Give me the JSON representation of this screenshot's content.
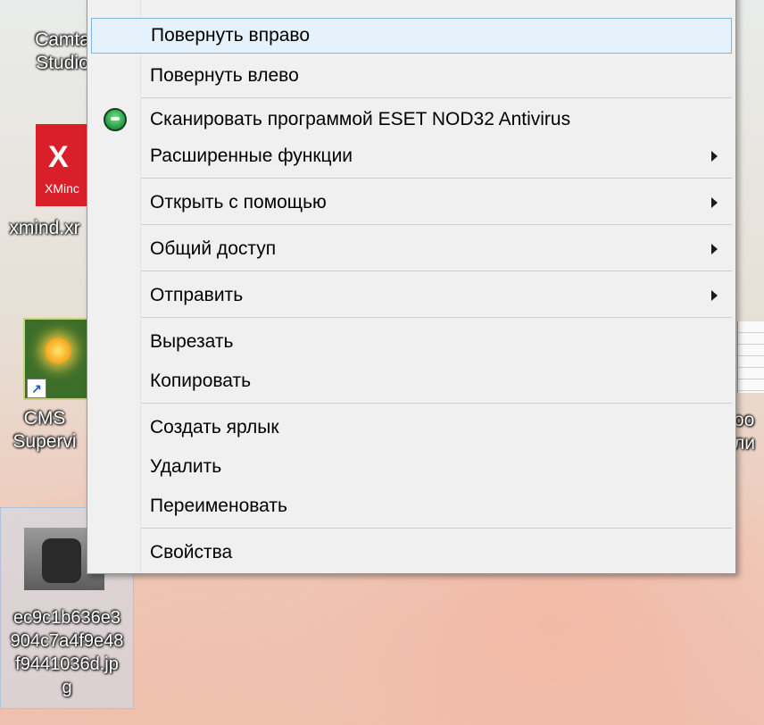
{
  "desktop": {
    "icons": [
      {
        "label_line1": "Camta",
        "label_line2": "Studio"
      },
      {
        "tile_letter": "X",
        "tile_text": "XMinc",
        "label_line1": "xmind.xr"
      },
      {
        "label_line1": "CMS",
        "label_line2": "Supervi"
      },
      {
        "label_line1": "ec9c1b636e3",
        "label_line2": "904c7a4f9e48",
        "label_line3": "f9441036d.jp",
        "label_line4": "g"
      }
    ],
    "right_partial_label_line1": "oo",
    "right_partial_label_line2": "ли"
  },
  "context_menu": {
    "items": [
      {
        "label": "Повернуть вправо",
        "highlighted": true,
        "submenu": false
      },
      {
        "label": "Повернуть влево",
        "submenu": false
      },
      {
        "label": "Сканировать программой ESET NOD32 Antivirus",
        "icon": "eset-icon",
        "submenu": false
      },
      {
        "label": "Расширенные функции",
        "submenu": true
      },
      {
        "label": "Открыть с помощью",
        "submenu": true
      },
      {
        "label": "Общий доступ",
        "submenu": true
      },
      {
        "label": "Отправить",
        "submenu": true
      },
      {
        "label": "Вырезать",
        "submenu": false
      },
      {
        "label": "Копировать",
        "submenu": false
      },
      {
        "label": "Создать ярлык",
        "submenu": false
      },
      {
        "label": "Удалить",
        "submenu": false
      },
      {
        "label": "Переименовать",
        "submenu": false
      },
      {
        "label": "Свойства",
        "submenu": false
      }
    ]
  },
  "colors": {
    "menu_background": "#f0f0f0",
    "highlight_background": "#e5f1fb",
    "highlight_border": "#79b7e6"
  }
}
